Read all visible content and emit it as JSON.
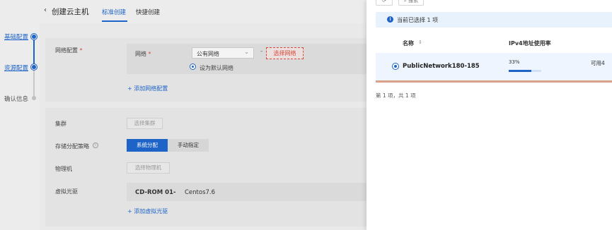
{
  "steps": [
    {
      "label": "基础配置",
      "active": true
    },
    {
      "label": "资源配置",
      "active": true
    },
    {
      "label": "确认信息",
      "active": false
    }
  ],
  "header": {
    "back": "‹",
    "title": "创建云主机",
    "tabs": [
      "标准创建",
      "快捷创建"
    ]
  },
  "network": {
    "section_label": "网络配置",
    "required_mark": "*",
    "field_label": "网络",
    "select_value": "公有网络",
    "dash": "-",
    "pick_button": "选择网络",
    "default_radio": "设为默认网络",
    "add_link": "+ 添加网络配置"
  },
  "resource": {
    "cluster_label": "集群",
    "cluster_button": "选择集群",
    "storage_label": "存储分配策略",
    "storage_options": [
      "系统分配",
      "手动指定"
    ],
    "physical_label": "物理机",
    "physical_button": "选择物理机",
    "cdrom_label": "虚拟光驱",
    "cdrom_name": "CD-ROM 01",
    "cdrom_dash": "-",
    "cdrom_image": "Centos7.6",
    "add_cdrom": "+ 添加虚拟光驱"
  },
  "drawer": {
    "top_buttons": [
      "",
      "搜索"
    ],
    "notice": "当前已选择 1 项",
    "col_name": "名称",
    "sort_icon": "⇕",
    "col_usage": "IPv4地址使用率",
    "row": {
      "name": "PublicNetwork180-185",
      "percent_label": "33%",
      "usage": 0.33,
      "available": "可用4"
    },
    "pager": "第 1 项，共 1 项"
  },
  "colors": {
    "accent": "#1e63c8",
    "danger": "#d9483b"
  }
}
